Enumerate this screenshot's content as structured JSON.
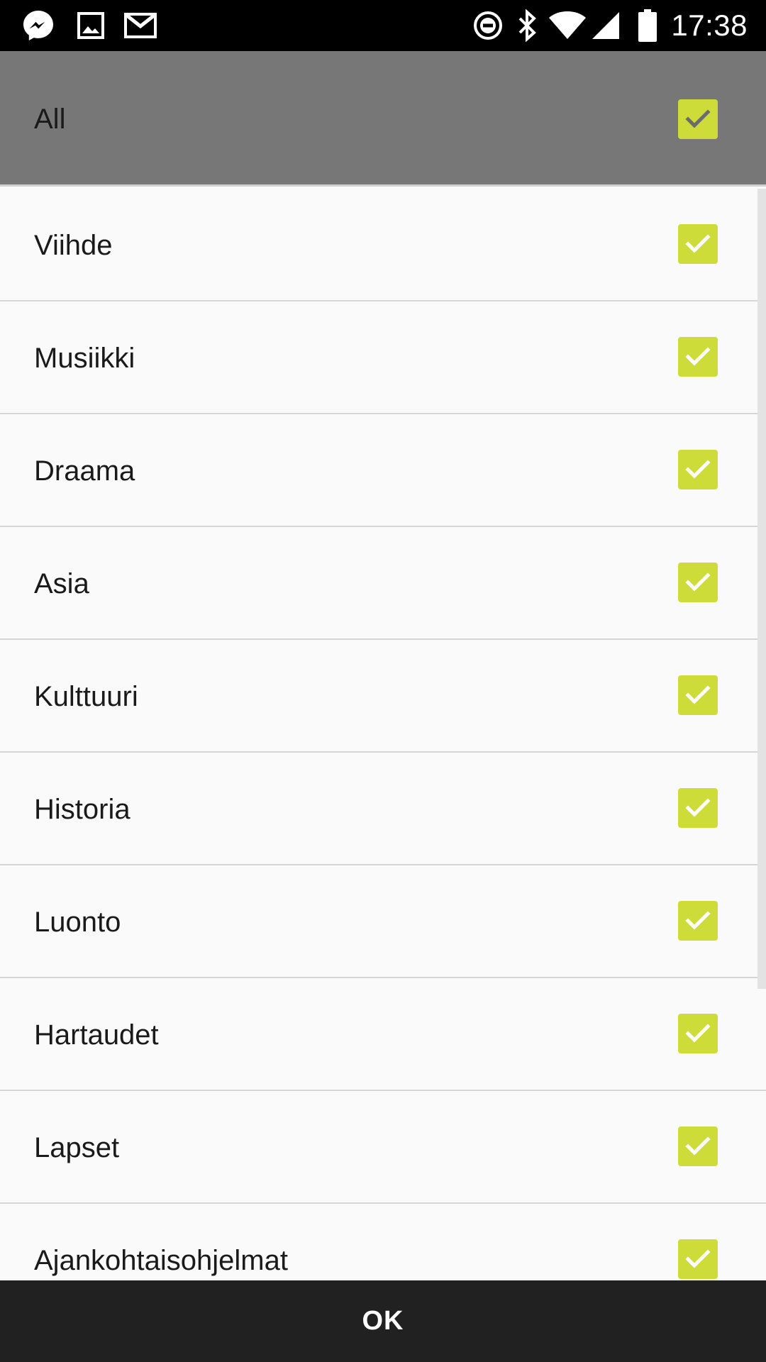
{
  "status_bar": {
    "time": "17:38",
    "left_icons": [
      "messenger-icon",
      "gallery-icon",
      "gmail-icon"
    ],
    "right_icons": [
      "do-not-disturb-icon",
      "bluetooth-icon",
      "wifi-icon",
      "signal-icon",
      "battery-icon"
    ]
  },
  "all_option": {
    "label": "All",
    "checked": true
  },
  "categories": [
    {
      "label": "Viihde",
      "checked": true
    },
    {
      "label": "Musiikki",
      "checked": true
    },
    {
      "label": "Draama",
      "checked": true
    },
    {
      "label": "Asia",
      "checked": true
    },
    {
      "label": "Kulttuuri",
      "checked": true
    },
    {
      "label": "Historia",
      "checked": true
    },
    {
      "label": "Luonto",
      "checked": true
    },
    {
      "label": "Hartaudet",
      "checked": true
    },
    {
      "label": "Lapset",
      "checked": true
    },
    {
      "label": "Ajankohtaisohjelmat",
      "checked": true
    }
  ],
  "ok_button": {
    "label": "OK"
  },
  "colors": {
    "checkbox_checked": "#cddc39",
    "header_background": "#777777",
    "bottom_bar": "#212121",
    "status_bar": "#000000"
  }
}
